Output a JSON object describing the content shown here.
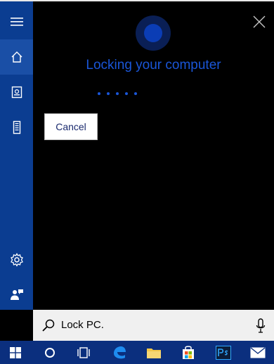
{
  "cortana": {
    "title": "Locking your computer",
    "cancel_label": "Cancel"
  },
  "search": {
    "query": "Lock PC."
  },
  "icons": {
    "menu": "hamburger-icon",
    "home": "home-icon",
    "notebook": "notebook-icon",
    "devices": "phone-icon",
    "settings": "gear-icon",
    "feedback": "feedback-icon",
    "close": "close-icon",
    "search": "search-icon",
    "mic": "microphone-icon",
    "start": "windows-start-icon",
    "cortana": "cortana-circle-icon",
    "taskview": "task-view-icon",
    "edge": "edge-icon",
    "explorer": "file-explorer-icon",
    "store": "store-icon",
    "photoshop": "photoshop-icon",
    "mail": "mail-icon"
  },
  "colors": {
    "accent": "#1a56d8",
    "sidebar": "#0b3d91",
    "taskbar": "#0b2f7e"
  }
}
